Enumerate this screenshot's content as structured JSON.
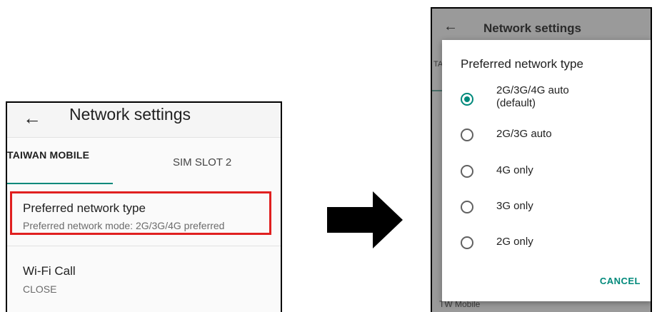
{
  "left": {
    "back_icon": "arrow-left-icon",
    "title": "Network settings",
    "tabs": [
      "TAIWAN MOBILE",
      "SIM SLOT 2"
    ],
    "preferred": {
      "title": "Preferred network type",
      "summary": "Preferred network mode: 2G/3G/4G preferred"
    },
    "wifi": {
      "title": "Wi-Fi Call",
      "summary": "CLOSE"
    },
    "highlight_color": "#e02020",
    "accent_color": "#00897b"
  },
  "arrow_icon": "arrow-right-icon",
  "right": {
    "back_icon": "arrow-left-icon",
    "title": "Network settings",
    "tab_fragment": "TA",
    "bottom_text": "TW Mobile",
    "dialog": {
      "title": "Preferred network type",
      "options": [
        {
          "label_line1": "2G/3G/4G auto",
          "label_line2": "(default)",
          "selected": true
        },
        {
          "label_line1": "2G/3G auto",
          "selected": false
        },
        {
          "label_line1": "4G only",
          "selected": false
        },
        {
          "label_line1": "3G only",
          "selected": false
        },
        {
          "label_line1": "2G only",
          "selected": false
        }
      ],
      "cancel_label": "CANCEL"
    }
  }
}
